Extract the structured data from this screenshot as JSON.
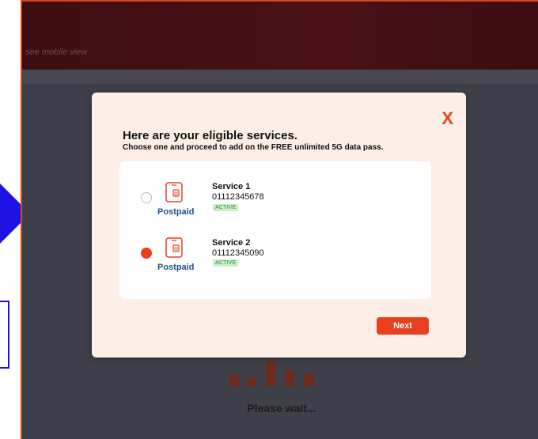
{
  "header": {
    "hint": "see mobile view"
  },
  "background": {
    "loading_text": "Please wait..."
  },
  "modal": {
    "close_label": "X",
    "title": "Here are your eligible services.",
    "subtitle": "Choose one and proceed to add on the FREE unlimited 5G data pass.",
    "services": [
      {
        "name": "Service 1",
        "number": "01112345678",
        "status": "ACTIVE",
        "plan": "Postpaid",
        "selected": false
      },
      {
        "name": "Service 2",
        "number": "01112345090",
        "status": "ACTIVE",
        "plan": "Postpaid",
        "selected": true
      }
    ],
    "next_label": "Next"
  },
  "colors": {
    "accent": "#e8401f",
    "plan_text": "#1f4f8f",
    "badge_bg": "#cdeec9",
    "badge_text": "#2e8b3a",
    "modal_bg": "#fdeee6"
  },
  "icons": {
    "phone": "phone-sim-icon"
  }
}
